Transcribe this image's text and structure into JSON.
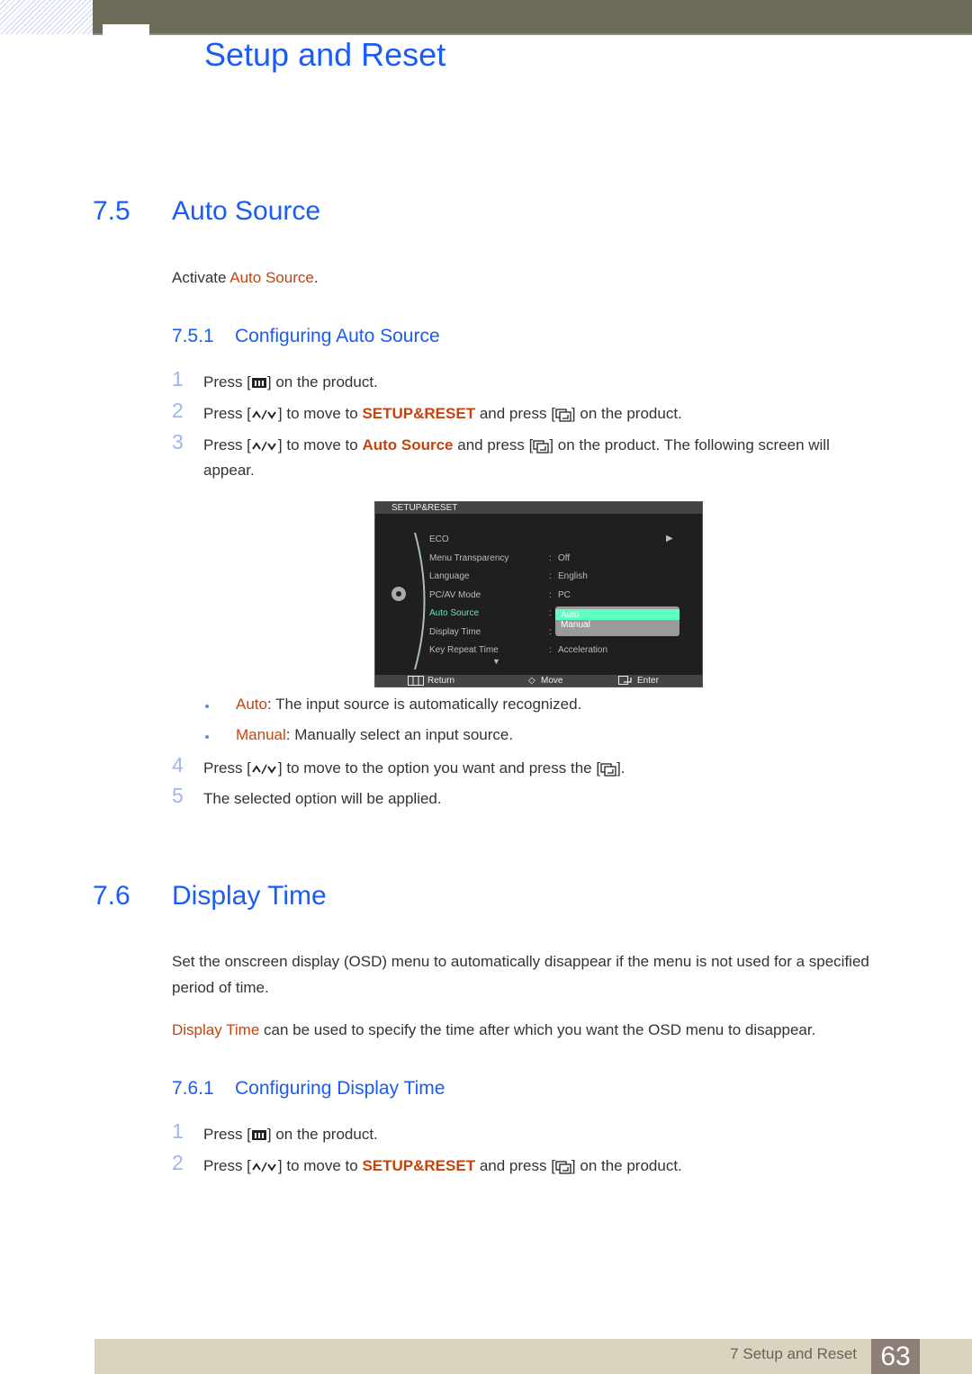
{
  "header": {
    "chapter_title": "Setup and Reset"
  },
  "section_7_5": {
    "number": "7.5",
    "title": "Auto Source",
    "intro_prefix": "Activate ",
    "intro_highlight": "Auto Source",
    "intro_suffix": ".",
    "subsection": {
      "number": "7.5.1",
      "title": "Configuring Auto Source"
    },
    "steps": [
      {
        "n": "1",
        "pre": "Press [",
        "post": "] on the product."
      },
      {
        "n": "2",
        "pre": "Press [",
        "mid": "] to move to ",
        "highlight": "SETUP&RESET",
        "mid2": " and press [",
        "post": "] on the product."
      },
      {
        "n": "3",
        "pre": "Press [",
        "mid": "] to move to ",
        "highlight": "Auto Source",
        "mid2": " and press [",
        "post": "] on the product. The following screen will appear."
      },
      {
        "n": "4",
        "pre": "Press [",
        "mid": "] to move to the option you want and press the [",
        "post": "]."
      },
      {
        "n": "5",
        "text": "The selected option will be applied."
      }
    ],
    "bullets": [
      {
        "term": "Auto",
        "text": ": The input source is automatically recognized."
      },
      {
        "term": "Manual",
        "text": ": Manually select an input source."
      }
    ]
  },
  "osd": {
    "title": "SETUP&RESET",
    "items": [
      {
        "label": "ECO",
        "value": ""
      },
      {
        "label": "Menu Transparency",
        "value": "Off"
      },
      {
        "label": "Language",
        "value": "English"
      },
      {
        "label": "PC/AV Mode",
        "value": "PC"
      },
      {
        "label": "Auto Source",
        "value": ""
      },
      {
        "label": "Display Time",
        "value": ""
      },
      {
        "label": "Key Repeat Time",
        "value": "Acceleration"
      }
    ],
    "dropdown": {
      "selected": "Auto",
      "other": "Manual"
    },
    "footer": {
      "return": "Return",
      "move": "Move",
      "enter": "Enter"
    },
    "colors": {
      "active": "#5fe8b8",
      "selected_bg": "#5fffc2"
    }
  },
  "section_7_6": {
    "number": "7.6",
    "title": "Display Time",
    "para1": "Set the onscreen display (OSD) menu to automatically disappear if the menu is not used for a specified period of time.",
    "para2_highlight": "Display Time",
    "para2_rest": " can be used to specify the time after which you want the OSD menu to disappear.",
    "subsection": {
      "number": "7.6.1",
      "title": "Configuring Display Time"
    },
    "steps": [
      {
        "n": "1",
        "pre": "Press [",
        "post": "] on the product."
      },
      {
        "n": "2",
        "pre": "Press [",
        "mid": "] to move to ",
        "highlight": "SETUP&RESET",
        "mid2": " and press [",
        "post": "] on the product."
      }
    ]
  },
  "footer": {
    "chapter_label": "7 Setup and Reset",
    "page_number": "63"
  },
  "colors": {
    "heading_blue": "#1a5cf5",
    "highlight_orange": "#c8420c",
    "step_number": "#9fb5ee",
    "topbar": "#6d6c59",
    "footer_bar": "#d9d3c0",
    "page_badge": "#8d7f77"
  }
}
